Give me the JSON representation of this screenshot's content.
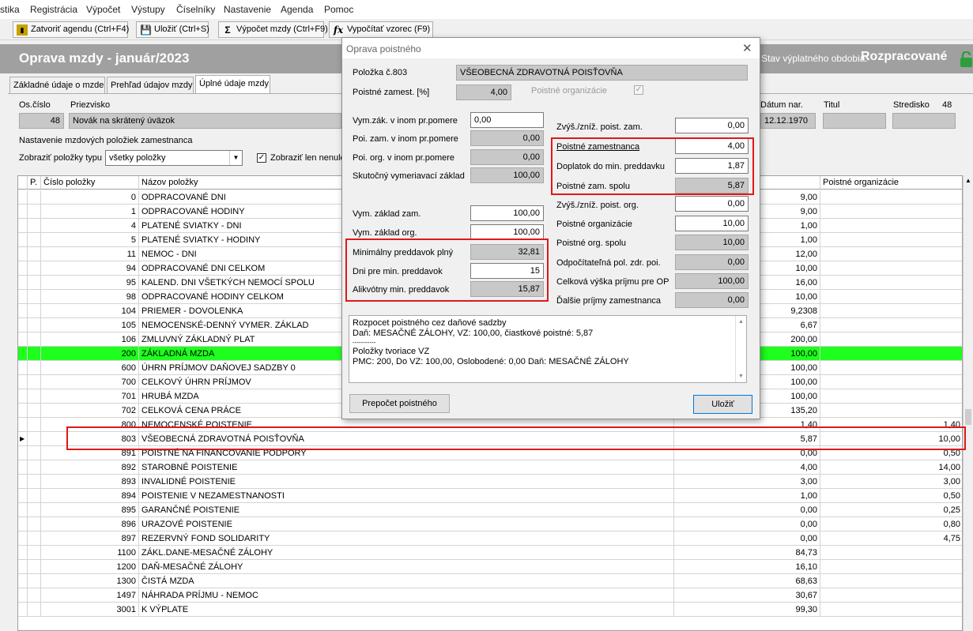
{
  "menu": [
    "stika",
    "Registrácia",
    "Výpočet",
    "Výstupy",
    "Číselníky",
    "Nastavenie",
    "Agenda",
    "Pomoc"
  ],
  "toolbar": {
    "close_agenda": "Zatvoriť agendu (Ctrl+F4)",
    "save": "Uložiť (Ctrl+S)",
    "calc_wage": "Výpočet mzdy (Ctrl+F9)",
    "calc_formula": "Vypočítať vzorec (F9)"
  },
  "header": {
    "title": "Oprava mzdy -  január/2023",
    "state_label": "Stav výplatného obdobia:",
    "state_value": "Rozpracované"
  },
  "tabs": [
    "Základné údaje o mzde",
    "Prehľad údajov mzdy",
    "Úplné údaje mzdy"
  ],
  "employee": {
    "oscislo_label": "Os.číslo",
    "oscislo": "48",
    "priezvisko_label": "Priezvisko",
    "priezvisko": "Novák na skrátený úväzok",
    "datum_label": "Dátum nar.",
    "datum": "12.12.1970",
    "titul_label": "Titul",
    "titul": "",
    "stredisko_label": "Stredisko",
    "stredisko": "48"
  },
  "settings": {
    "section_label": "Nastavenie mzdových položiek zamestnanca",
    "type_label": "Zobraziť položky typu",
    "type_value": "všetky položky",
    "nonzero_label": "Zobraziť len nenulo"
  },
  "grid": {
    "headers": {
      "p": "P.",
      "cislo": "Číslo položky",
      "nazov": "Názov položky",
      "org": "Poistné organizácie"
    },
    "rows": [
      {
        "cislo": "0",
        "nazov": "ODPRACOVANÉ DNI",
        "val": "9,00",
        "org": ""
      },
      {
        "cislo": "1",
        "nazov": "ODPRACOVANÉ HODINY",
        "val": "9,00",
        "org": ""
      },
      {
        "cislo": "4",
        "nazov": "PLATENÉ SVIATKY - DNI",
        "val": "1,00",
        "org": ""
      },
      {
        "cislo": "5",
        "nazov": "PLATENÉ SVIATKY - HODINY",
        "val": "1,00",
        "org": ""
      },
      {
        "cislo": "11",
        "nazov": "NEMOC - DNI",
        "val": "12,00",
        "org": ""
      },
      {
        "cislo": "94",
        "nazov": "ODPRACOVANÉ DNI CELKOM",
        "val": "10,00",
        "org": ""
      },
      {
        "cislo": "95",
        "nazov": "KALEND. DNI VŠETKÝCH NEMOCÍ SPOLU",
        "val": "16,00",
        "org": ""
      },
      {
        "cislo": "98",
        "nazov": "ODPRACOVANÉ HODINY CELKOM",
        "val": "10,00",
        "org": ""
      },
      {
        "cislo": "104",
        "nazov": "PRIEMER - DOVOLENKA",
        "val": "9,2308",
        "org": ""
      },
      {
        "cislo": "105",
        "nazov": "NEMOCENSKÉ-DENNÝ VYMER. ZÁKLAD",
        "val": "6,67",
        "org": ""
      },
      {
        "cislo": "106",
        "nazov": "ZMLUVNÝ ZÁKLADNÝ PLAT",
        "val": "200,00",
        "org": ""
      },
      {
        "cislo": "200",
        "nazov": "ZÁKLADNÁ MZDA",
        "val": "100,00",
        "org": ""
      },
      {
        "cislo": "600",
        "nazov": "ÚHRN PRÍJMOV DAŇOVEJ SADZBY 0",
        "val": "100,00",
        "org": ""
      },
      {
        "cislo": "700",
        "nazov": "CELKOVÝ ÚHRN PRÍJMOV",
        "val": "100,00",
        "org": ""
      },
      {
        "cislo": "701",
        "nazov": "HRUBÁ MZDA",
        "val": "100,00",
        "org": ""
      },
      {
        "cislo": "702",
        "nazov": "CELKOVÁ CENA PRÁCE",
        "val": "135,20",
        "org": ""
      },
      {
        "cislo": "800",
        "nazov": "NEMOCENSKÉ POISTENIE",
        "val": "1,40",
        "org": "1,40"
      },
      {
        "cislo": "803",
        "nazov": "VŠEOBECNÁ ZDRAVOTNÁ POISŤOVŇA",
        "val": "5,87",
        "org": "10,00"
      },
      {
        "cislo": "891",
        "nazov": "POISTNÉ NA FINANCOVANIE PODPORY",
        "val": "0,00",
        "org": "0,50"
      },
      {
        "cislo": "892",
        "nazov": "STAROBNÉ POISTENIE",
        "val": "4,00",
        "org": "14,00"
      },
      {
        "cislo": "893",
        "nazov": "INVALIDNÉ POISTENIE",
        "val": "3,00",
        "org": "3,00"
      },
      {
        "cislo": "894",
        "nazov": "POISTENIE V NEZAMESTNANOSTI",
        "val": "1,00",
        "org": "0,50"
      },
      {
        "cislo": "895",
        "nazov": "GARANČNÉ POISTENIE",
        "val": "0,00",
        "org": "0,25"
      },
      {
        "cislo": "896",
        "nazov": "URAZOVÉ POISTENIE",
        "val": "0,00",
        "org": "0,80"
      },
      {
        "cislo": "897",
        "nazov": "REZERVNÝ FOND SOLIDARITY",
        "val": "0,00",
        "org": "4,75"
      },
      {
        "cislo": "1100",
        "nazov": "ZÁKL.DANE-MESAČNÉ ZÁLOHY",
        "val": "84,73",
        "org": ""
      },
      {
        "cislo": "1200",
        "nazov": "DAŇ-MESAČNÉ ZÁLOHY",
        "val": "16,10",
        "org": ""
      },
      {
        "cislo": "1300",
        "nazov": "ČISTÁ MZDA",
        "val": "68,63",
        "org": ""
      },
      {
        "cislo": "1497",
        "nazov": "NÁHRADA PRÍJMU - NEMOC",
        "val": "30,67",
        "org": ""
      },
      {
        "cislo": "3001",
        "nazov": "K VÝPLATE",
        "val": "99,30",
        "org": ""
      }
    ]
  },
  "dialog": {
    "title": "Oprava poistného",
    "polozka_label": "Položka č.803",
    "polozka_name": "VŠEOBECNÁ ZDRAVOTNÁ POISŤOVŇA",
    "poistne_zamest_label": "Poistné zamest. [%]",
    "poistne_zamest": "4,00",
    "poistne_org_label": "Poistné organizácie",
    "left": {
      "vym_zak_label": "Vym.zák. v inom pr.pomere",
      "vym_zak": "0,00",
      "poi_zam_label": "Poi. zam. v inom pr.pomere",
      "poi_zam": "0,00",
      "poi_org_label": "Poi. org. v inom pr.pomere",
      "poi_org": "0,00",
      "skut_label": "Skutočný vymeriavací základ",
      "skut": "100,00",
      "vym_zam_label": "Vym. základ zam.",
      "vym_zam": "100,00",
      "vym_org_label": "Vym. základ org.",
      "vym_org": "100,00",
      "min_label": "Minimálny preddavok plný",
      "min": "32,81",
      "dni_label": "Dni pre min. preddavok",
      "dni": "15",
      "alik_label": "Alikvótny min. preddavok",
      "alik": "15,87"
    },
    "right": {
      "zvys_zam_label": "Zvýš./zníž. poist. zam.",
      "zvys_zam": "0,00",
      "pz_label": "Poistné zamestnanca",
      "pz": "4,00",
      "dopl_label": "Doplatok do min. preddavku",
      "dopl": "1,87",
      "pzs_label": "Poistné zam. spolu",
      "pzs": "5,87",
      "zvys_org_label": "Zvýš./zníž. poist. org.",
      "zvys_org": "0,00",
      "po_label": "Poistné organizácie",
      "po": "10,00",
      "pos_label": "Poistné org. spolu",
      "pos": "10,00",
      "odp_label": "Odpočítateľná pol. zdr. poi.",
      "odp": "0,00",
      "celk_label": "Celková výška príjmu pre OP",
      "celk": "100,00",
      "dalsie_label": "Ďalšie príjmy zamestnanca",
      "dalsie": "0,00"
    },
    "memo": [
      "Rozpocet poistného cez daňové sadzby",
      "Daň: MESAČNÉ ZÁLOHY, VZ: 100,00, čiastkové poistné: 5,87",
      "-----------",
      "Položky tvoriace VZ",
      "PMC: 200, Do VZ: 100,00, Oslobodené: 0,00 Daň: MESAČNÉ ZÁLOHY"
    ],
    "recalc_button": "Prepočet  poistného",
    "save_button": "Uložiť"
  },
  "colors": {
    "highlight_row": "#1eff1e",
    "annotation": "#e01818",
    "header_band": "#a0a0a0"
  }
}
